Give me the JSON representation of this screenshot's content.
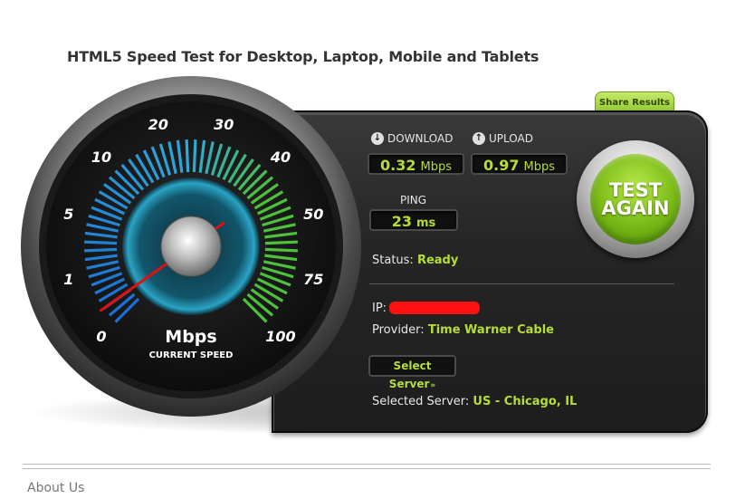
{
  "page_title": "HTML5 Speed Test for Desktop, Laptop, Mobile and Tablets",
  "share_label": "Share Results",
  "gauge": {
    "ticks": [
      "0",
      "1",
      "5",
      "10",
      "20",
      "30",
      "40",
      "50",
      "75",
      "100"
    ],
    "unit": "Mbps",
    "caption": "CURRENT SPEED",
    "needle_value": 0.32,
    "colors": {
      "blue": "#1a6fd6",
      "cyan": "#2fa8d8",
      "green": "#4cc13a"
    }
  },
  "download": {
    "label": "DOWNLOAD",
    "value": "0.32",
    "unit": "Mbps",
    "icon": "arrow-down-icon"
  },
  "upload": {
    "label": "UPLOAD",
    "value": "0.97",
    "unit": "Mbps",
    "icon": "arrow-up-icon"
  },
  "ping": {
    "label": "PING",
    "value": "23",
    "unit": "ms"
  },
  "status": {
    "label": "Status:",
    "value": "Ready"
  },
  "ip": {
    "label": "IP:"
  },
  "provider": {
    "label": "Provider:",
    "value": "Time Warner Cable"
  },
  "select_server": {
    "label": "Select Server"
  },
  "selected_server": {
    "label": "Selected Server:",
    "value": "US - Chicago, IL"
  },
  "test_button": {
    "line1": "TEST",
    "line2": "AGAIN"
  },
  "footer": {
    "about": "About Us"
  },
  "colors": {
    "accent": "#b5dd36",
    "panel": "#262626",
    "button_green": "#79b916",
    "redaction": "#ff1010"
  }
}
